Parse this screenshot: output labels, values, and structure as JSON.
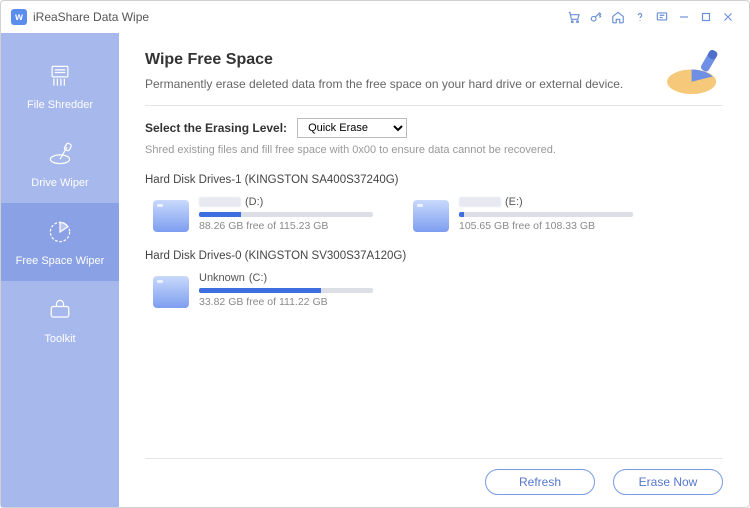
{
  "titlebar": {
    "title": "iReaShare Data Wipe",
    "logo": "w"
  },
  "sidebar": {
    "items": [
      {
        "label": "File Shredder"
      },
      {
        "label": "Drive Wiper"
      },
      {
        "label": "Free Space Wiper"
      },
      {
        "label": "Toolkit"
      }
    ]
  },
  "main": {
    "heading": "Wipe Free Space",
    "subtitle": "Permanently erase deleted data from the free space on your hard drive or external device.",
    "select_label": "Select the Erasing Level:",
    "select_value": "Quick Erase",
    "select_desc": "Shred existing files and fill free space with 0x00 to ensure data cannot be recovered."
  },
  "disks": [
    {
      "title": "Hard Disk Drives-1 (KINGSTON SA400S37240G)",
      "drives": [
        {
          "name_prefix": "",
          "letter": "(D:)",
          "free": "88.26 GB free of 115.23 GB",
          "fill_pct": 24,
          "redacted": true
        },
        {
          "name_prefix": "",
          "letter": "(E:)",
          "free": "105.65 GB free of 108.33 GB",
          "fill_pct": 3,
          "redacted": true
        }
      ]
    },
    {
      "title": "Hard Disk Drives-0 (KINGSTON SV300S37A120G)",
      "drives": [
        {
          "name_prefix": "Unknown",
          "letter": "(C:)",
          "free": "33.82 GB free of 111.22 GB",
          "fill_pct": 70,
          "redacted": false
        }
      ]
    }
  ],
  "footer": {
    "refresh": "Refresh",
    "erase": "Erase Now"
  }
}
